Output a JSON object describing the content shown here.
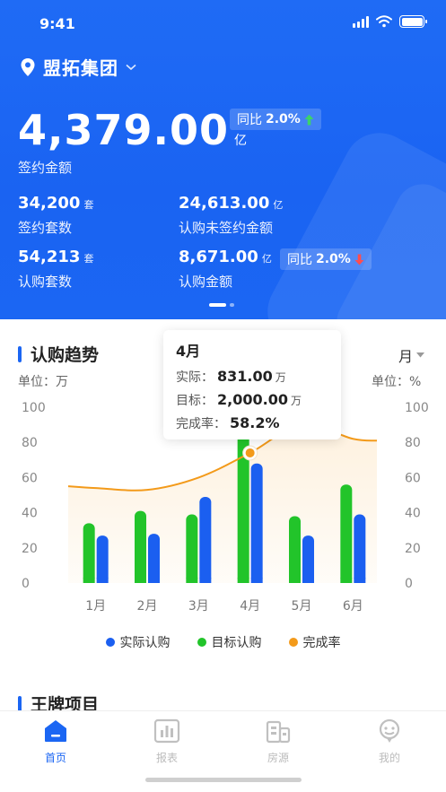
{
  "status_bar": {
    "time": "9:41"
  },
  "header": {
    "company": "盟拓集团",
    "main_value": "4,379.00",
    "main_unit": "亿",
    "main_label": "签约金额",
    "yoy_label": "同比",
    "yoy_value_1": "2.0%",
    "yoy_value_2": "2.0%",
    "stats": [
      {
        "value": "34,200",
        "unit": "套",
        "label": "签约套数"
      },
      {
        "value": "24,613.00",
        "unit": "亿",
        "label": "认购未签约金额"
      },
      {
        "value": "54,213",
        "unit": "套",
        "label": "认购套数"
      },
      {
        "value": "8,671.00",
        "unit": "亿",
        "label": "认购金额"
      }
    ],
    "colors": {
      "up": "#3cd26a",
      "down": "#ff4d4f"
    }
  },
  "trend": {
    "title": "认购趋势",
    "period": "月",
    "unit_left": "单位：万",
    "unit_right": "单位：%",
    "tooltip": {
      "title": "4月",
      "actual_label": "实际：",
      "actual_value": "831.00",
      "actual_unit": "万",
      "target_label": "目标：",
      "target_value": "2,000.00",
      "target_unit": "万",
      "rate_label": "完成率：",
      "rate_value": "58.2%"
    },
    "legend": [
      "实际认购",
      "目标认购",
      "完成率"
    ]
  },
  "chart_data": {
    "type": "bar",
    "categories": [
      "1月",
      "2月",
      "3月",
      "4月",
      "5月",
      "6月"
    ],
    "y_ticks": [
      "100",
      "80",
      "60",
      "40",
      "20",
      "0"
    ],
    "ylim": [
      0,
      100
    ],
    "y2lim": [
      0,
      100
    ],
    "series": [
      {
        "name": "实际认购",
        "type": "bar",
        "color": "#1b5ff0",
        "values": [
          27,
          28,
          49,
          68,
          27,
          39
        ]
      },
      {
        "name": "目标认购",
        "type": "bar",
        "color": "#22c42a",
        "values": [
          34,
          41,
          39,
          85,
          38,
          56
        ]
      },
      {
        "name": "完成率",
        "type": "line",
        "color": "#f39a1a",
        "values": [
          54,
          53,
          60,
          74,
          90,
          82
        ]
      }
    ],
    "highlight_index": 3
  },
  "brand": {
    "title": "王牌项目"
  },
  "tabbar": {
    "items": [
      {
        "label": "首页",
        "icon": "home-icon",
        "active": true
      },
      {
        "label": "报表",
        "icon": "report-icon",
        "active": false
      },
      {
        "label": "房源",
        "icon": "building-icon",
        "active": false
      },
      {
        "label": "我的",
        "icon": "profile-icon",
        "active": false
      }
    ],
    "active_color": "#1b66f3",
    "inactive_color": "#c0c0c0"
  }
}
